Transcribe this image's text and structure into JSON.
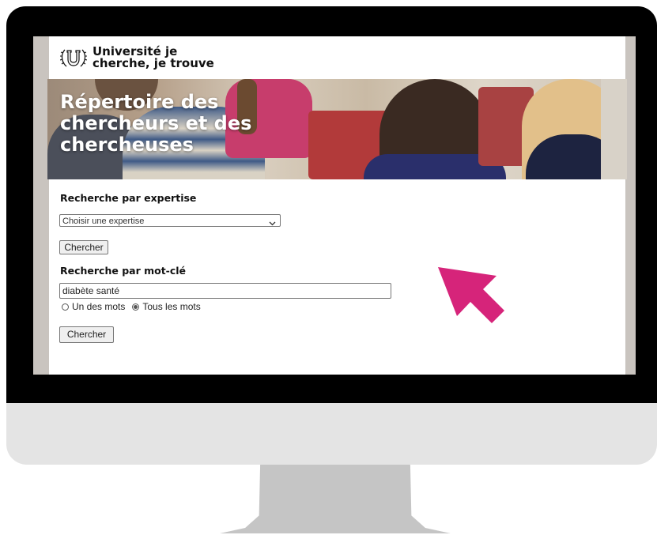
{
  "site": {
    "logo_text": "Université je cherche, je trouve"
  },
  "banner": {
    "title": "Répertoire des chercheurs et des chercheuses"
  },
  "expertise_search": {
    "heading": "Recherche par expertise",
    "select_value": "Choisir une expertise",
    "button_label": "Chercher"
  },
  "keyword_search": {
    "heading": "Recherche par mot-clé",
    "input_value": "diabète santé",
    "radio_any_label": "Un des mots",
    "radio_all_label": "Tous les mots",
    "selected_option": "Tous les mots",
    "button_label": "Chercher"
  },
  "colors": {
    "pointer_arrow": "#d6247a",
    "bezel": "#000000",
    "chin": "#e4e4e4",
    "stand": "#c5c5c5"
  },
  "icons": {
    "logo": "u-laurel-logo-icon",
    "select_chevron": "chevron-down-icon",
    "pointer": "pointer-arrow-icon"
  }
}
